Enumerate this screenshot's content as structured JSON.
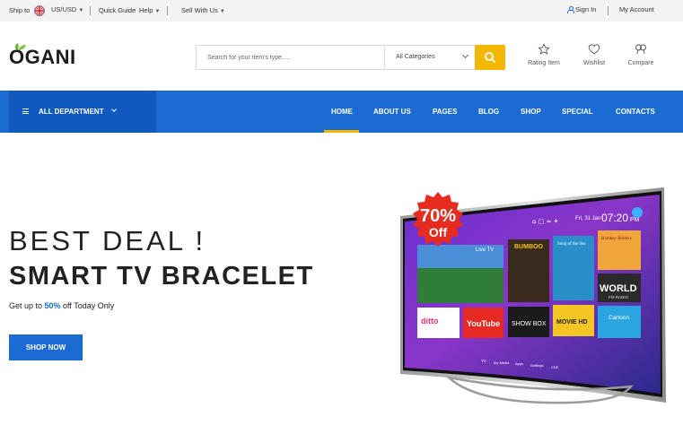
{
  "topbar": {
    "ship_to": "Ship to",
    "currency": "US/USD",
    "quick_guide": "Quick Guide",
    "help": "Help",
    "sell_with_us": "Sell With Us",
    "sign_in": "Sign In",
    "my_account": "My Account"
  },
  "header": {
    "logo": "OGANI",
    "search_placeholder": "Search for your item's type.....",
    "category": "All Categories",
    "rating_label": "Rating Item",
    "wishlist_label": "Wishlist",
    "compare_label": "Compare"
  },
  "nav": {
    "department": "ALL DEPARTMENT",
    "items": [
      "HOME",
      "ABOUT US",
      "PAGES",
      "BLOG",
      "SHOP",
      "SPECIAL",
      "CONTACTS"
    ],
    "active": "HOME"
  },
  "hero": {
    "eyebrow": "BEST DEAL !",
    "title": "SMART TV BRACELET",
    "sub_before": "Get up to ",
    "sub_pct": "50%",
    "sub_after": " off Today Only",
    "button": "SHOP NOW",
    "badge_pct": "70%",
    "badge_off": "Off"
  },
  "tv_screen": {
    "time": "07:20",
    "period": "PM",
    "date": "Fri, 31 Jan",
    "apps": [
      "Live TV",
      "BUMBOO",
      "Song of the Sea",
      "Bombay Bolders",
      "ditto",
      "YouTube",
      "SHOW BOX",
      "MOVIE HD",
      "Cartoon",
      "WORLD",
      "FM RADIO"
    ],
    "dock": [
      "TV",
      "My Media",
      "Apps",
      "Settings",
      "CDE"
    ]
  },
  "colors": {
    "primary": "#1c6bd3",
    "department_bg": "#1259bf",
    "accent": "#f5b800",
    "badge": "#e52c1f",
    "topbar_bg": "#f3f3f3"
  }
}
